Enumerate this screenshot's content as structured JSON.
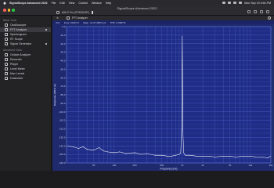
{
  "menubar": {
    "app_name": "SignalScope Advanced 2022",
    "items": [
      "File",
      "Edit",
      "View",
      "Control",
      "Window",
      "Help"
    ],
    "clock": "Mon Sep 19  6:54 PM"
  },
  "window": {
    "title": "SignalScope Advanced 2022",
    "device": "AW-S Pro (ST9D6V9F)"
  },
  "sidebar": {
    "sections": [
      {
        "header": "Basic Tools",
        "items": [
          {
            "label": "Oscilloscope",
            "icon": "oscilloscope-icon",
            "selected": false,
            "active": false
          },
          {
            "label": "FFT Analyzer",
            "icon": "fft-analyzer-icon",
            "selected": true,
            "active": true
          },
          {
            "label": "Spectrogram",
            "icon": "spectrogram-icon",
            "selected": false,
            "active": false
          },
          {
            "label": "RT Scope",
            "icon": "rt-scope-icon",
            "selected": false,
            "active": false
          },
          {
            "label": "Signal Generator",
            "icon": "signal-generator-icon",
            "selected": false,
            "active": true
          }
        ]
      },
      {
        "header": "Advanced Tools",
        "items": [
          {
            "label": "Octave Analyzer",
            "icon": "octave-analyzer-icon",
            "selected": false,
            "active": false
          },
          {
            "label": "Recorder",
            "icon": "recorder-icon",
            "selected": false,
            "active": false
          },
          {
            "label": "Player",
            "icon": "player-icon",
            "selected": false,
            "active": false
          },
          {
            "label": "Level Meter",
            "icon": "level-meter-icon",
            "selected": false,
            "active": false
          },
          {
            "label": "Max Levels",
            "icon": "max-levels-icon",
            "selected": false,
            "active": false
          },
          {
            "label": "Dosimeter",
            "icon": "dosimeter-icon",
            "selected": false,
            "active": false
          }
        ]
      }
    ]
  },
  "panel": {
    "tab_label": "FFT Analyzer",
    "readout": {
      "cursor": "Ch1",
      "freq": "Freq: 1000 Hz",
      "mag": "Mag: -11.07 dBFS pk",
      "thd": "THD: 0.0087%"
    }
  },
  "colors": {
    "plot_bg": "#1f2d86",
    "grid": "#4a5fc4",
    "trace": "#ffffff"
  },
  "chart_data": {
    "type": "line",
    "title": "",
    "xlabel": "Frequency (Hz)",
    "ylabel": "Magnitude (dBFS pk)",
    "x_scale": "log",
    "xlim": [
      20,
      20000
    ],
    "ylim": [
      -160,
      0
    ],
    "grid": true,
    "yticks": [
      "0.0",
      "-10.0",
      "-20.0",
      "-30.0",
      "-40.0",
      "-50.0",
      "-60.0",
      "-70.0",
      "-80.0",
      "-90.0",
      "-100.0",
      "-110.0",
      "-120.0",
      "-130.0",
      "-140.0",
      "-150.0",
      "-160.0"
    ],
    "xticks": [
      {
        "value": 50,
        "label": "50"
      },
      {
        "value": 100,
        "label": "100"
      },
      {
        "value": 200,
        "label": "200"
      },
      {
        "value": 500,
        "label": "500"
      },
      {
        "value": 1000,
        "label": "1k"
      },
      {
        "value": 2000,
        "label": "2k"
      },
      {
        "value": 5000,
        "label": "5k"
      },
      {
        "value": 10000,
        "label": "10k"
      },
      {
        "value": 20000,
        "label": "20k"
      }
    ],
    "series": [
      {
        "x": [
          20,
          25,
          30,
          35,
          40,
          50,
          60,
          70,
          80,
          100,
          120,
          150,
          200,
          250,
          300,
          400,
          500,
          600,
          700,
          800,
          900,
          950,
          980,
          1000,
          1020,
          1050,
          1100,
          1300,
          1600,
          2000,
          2500,
          3000,
          4000,
          5000,
          6000,
          8000,
          10000,
          12000,
          15000,
          18000,
          20000
        ],
        "y": [
          -140,
          -141,
          -143,
          -141,
          -144,
          -145,
          -142,
          -146,
          -147,
          -148,
          -147,
          -149,
          -148,
          -150,
          -149,
          -151,
          -151,
          -152,
          -152,
          -151,
          -150,
          -148,
          -120,
          -11.07,
          -122,
          -148,
          -151,
          -151,
          -152,
          -152,
          -152,
          -153,
          -152,
          -152,
          -153,
          -152,
          -152,
          -153,
          -153,
          -154,
          -152
        ]
      }
    ]
  }
}
